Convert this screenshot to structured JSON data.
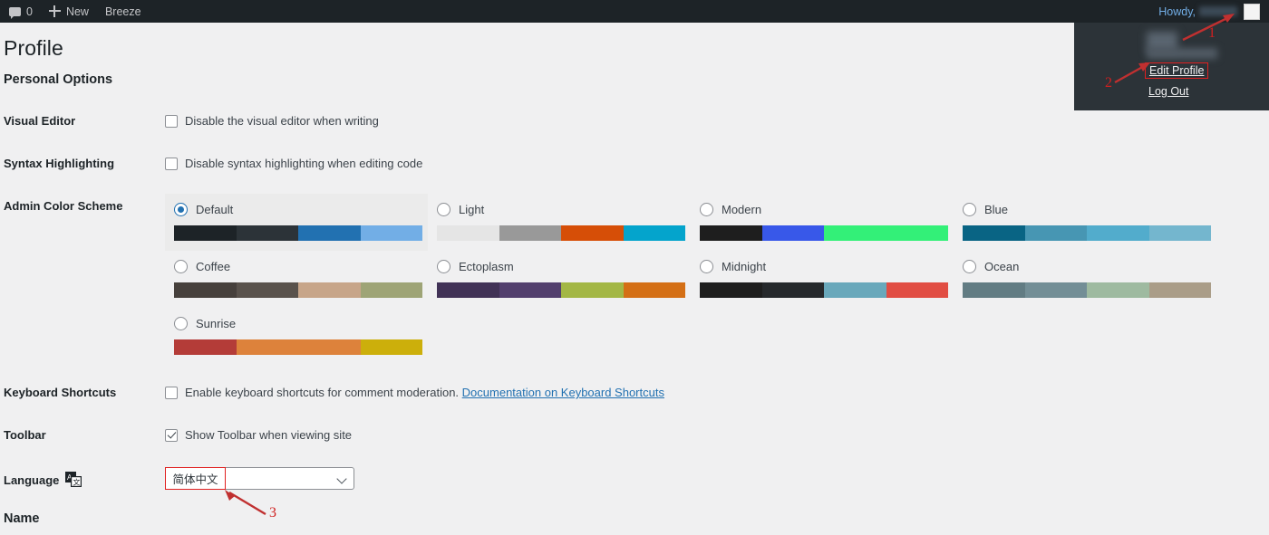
{
  "adminbar": {
    "comments_icon": "comment-bubble-icon",
    "comments_count": "0",
    "new_icon": "plus-icon",
    "new_label": "New",
    "site_label": "Breeze",
    "howdy_label": "Howdy,",
    "username_masked": "",
    "avatar_icon": "avatar"
  },
  "account_menu": {
    "edit_profile_label": "Edit Profile",
    "log_out_label": "Log Out"
  },
  "page": {
    "title": "Profile",
    "personal_options_heading": "Personal Options",
    "name_heading": "Name"
  },
  "rows": {
    "visual_editor": {
      "label": "Visual Editor",
      "checkbox_label": "Disable the visual editor when writing",
      "checked": false
    },
    "syntax_highlighting": {
      "label": "Syntax Highlighting",
      "checkbox_label": "Disable syntax highlighting when editing code",
      "checked": false
    },
    "admin_color_scheme": {
      "label": "Admin Color Scheme"
    },
    "keyboard_shortcuts": {
      "label": "Keyboard Shortcuts",
      "checkbox_label": "Enable keyboard shortcuts for comment moderation.",
      "doc_link_label": "Documentation on Keyboard Shortcuts",
      "checked": false
    },
    "toolbar": {
      "label": "Toolbar",
      "checkbox_label": "Show Toolbar when viewing site",
      "checked": true
    },
    "language": {
      "label": "Language",
      "icon": "translate-icon",
      "selected_value": "简体中文"
    }
  },
  "color_schemes": [
    {
      "name": "Default",
      "selected": true,
      "colors": [
        "#1d2327",
        "#2c3338",
        "#2271b1",
        "#72aee6"
      ]
    },
    {
      "name": "Light",
      "selected": false,
      "colors": [
        "#e5e5e5",
        "#999999",
        "#d64e07",
        "#04a4cc"
      ]
    },
    {
      "name": "Modern",
      "selected": false,
      "colors": [
        "#1e1e1e",
        "#3858e9",
        "#33f078",
        "#33f078"
      ]
    },
    {
      "name": "Blue",
      "selected": false,
      "colors": [
        "#096484",
        "#4796b3",
        "#52accc",
        "#74b6ce"
      ]
    },
    {
      "name": "Coffee",
      "selected": false,
      "colors": [
        "#46403c",
        "#59524c",
        "#c7a589",
        "#9ea476"
      ]
    },
    {
      "name": "Ectoplasm",
      "selected": false,
      "colors": [
        "#413256",
        "#523f6d",
        "#a3b745",
        "#d46f15"
      ]
    },
    {
      "name": "Midnight",
      "selected": false,
      "colors": [
        "#1e1e1e",
        "#26292c",
        "#69a8bb",
        "#e14d43"
      ]
    },
    {
      "name": "Ocean",
      "selected": false,
      "colors": [
        "#627c83",
        "#738e96",
        "#9ebaa0",
        "#aa9d88"
      ]
    },
    {
      "name": "Sunrise",
      "selected": false,
      "colors": [
        "#b43c38",
        "#dd823b",
        "#dd823b",
        "#ccaf0b"
      ]
    }
  ],
  "annotations": [
    {
      "id": "1",
      "target": "avatar"
    },
    {
      "id": "2",
      "target": "edit-profile"
    },
    {
      "id": "3",
      "target": "language-select"
    }
  ],
  "colors": {
    "adminbar_bg": "#1d2327",
    "menu_bg": "#2c3338",
    "page_bg": "#f0f0f1",
    "link": "#2271b1",
    "annotation": "#d02020",
    "selected_scheme_bg": "#ebebeb"
  }
}
